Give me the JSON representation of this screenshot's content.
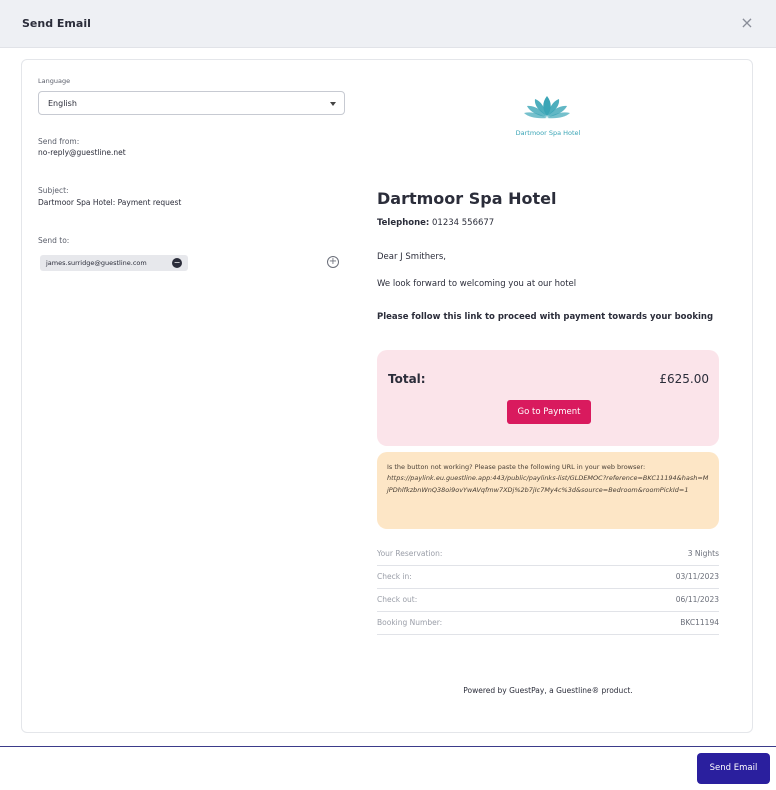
{
  "modal": {
    "title": "Send Email",
    "close_glyph": "×"
  },
  "form": {
    "language_label": "Language",
    "language_value": "English",
    "send_from_label": "Send from:",
    "send_from_value": "no-reply@guestline.net",
    "subject_label": "Subject:",
    "subject_value": "Dartmoor Spa Hotel: Payment request",
    "send_to_label": "Send to:",
    "recipients": [
      "james.surridge@guestline.com"
    ],
    "remove_glyph": "−",
    "add_glyph": "+"
  },
  "preview": {
    "logo_icon": "lotus-logo-icon",
    "logo_text": "Dartmoor Spa Hotel",
    "hotel_name": "Dartmoor Spa Hotel",
    "telephone_label": "Telephone:",
    "telephone_value": "01234 556677",
    "greeting": "Dear J Smithers,",
    "message": "We look forward to welcoming you at our hotel",
    "instruction": "Please follow this link to proceed with payment towards your booking",
    "total_label": "Total:",
    "total_value": "£625.00",
    "pay_button": "Go to Payment",
    "help_text": "Is the button not working? Please paste the following URL in your web browser:",
    "help_url": "https://paylink.eu.guestline.app:443/public/paylinks-list/GLDEMOC?reference=BKC11194&hash=MjPDhlfkzbnWnQ38oi9ovYwAVqfmw7XDj%2b7jIc7My4c%3d&source=Bedroom&roomPickId=1",
    "reservation": [
      {
        "label": "Your Reservation:",
        "value": "3 Nights"
      },
      {
        "label": "Check in:",
        "value": "03/11/2023"
      },
      {
        "label": "Check out:",
        "value": "06/11/2023"
      },
      {
        "label": "Booking Number:",
        "value": "BKC11194"
      }
    ],
    "powered_by": "Powered by GuestPay, a Guestline® product."
  },
  "footer": {
    "send_button": "Send Email"
  },
  "colors": {
    "brand": "#2a1f9e",
    "pay": "#d91a5e",
    "logo": "#3aa5b6"
  }
}
